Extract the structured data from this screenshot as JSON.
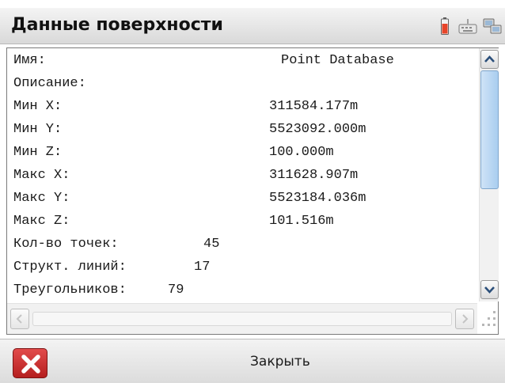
{
  "window": {
    "title": "Данные поверхности",
    "status_icons": [
      "battery-icon",
      "keyboard-icon",
      "network-icon"
    ],
    "colors": {
      "battery": "#e7452a",
      "close_button": "#c62a2a",
      "scroll_thumb": "#b9d6f2"
    }
  },
  "surface": {
    "name_label": "Имя:",
    "name_value": "Point Database",
    "description_label": "Описание:",
    "description_value": "",
    "min_x_label": "Мин X:",
    "min_x_value": "311584.177m",
    "min_y_label": "Мин Y:",
    "min_y_value": "5523092.000m",
    "min_z_label": "Мин Z:",
    "min_z_value": "100.000m",
    "max_x_label": "Макс X:",
    "max_x_value": "311628.907m",
    "max_y_label": "Макс Y:",
    "max_y_value": "5523184.036m",
    "max_z_label": "Макс Z:",
    "max_z_value": "101.516m",
    "points_label": "Кол-во точек:",
    "points_value": "45",
    "breaklines_label": "Структ. линий:",
    "breaklines_value": "17",
    "triangles_label": "Треугольников:",
    "triangles_value": "79"
  },
  "scrollbars": {
    "vertical": [
      "chevron-up-icon",
      "chevron-down-icon"
    ],
    "horizontal": [
      "chevron-left-icon",
      "chevron-right-icon"
    ]
  },
  "footer": {
    "close_label": "Закрыть",
    "close_icon": "close-x-icon"
  }
}
